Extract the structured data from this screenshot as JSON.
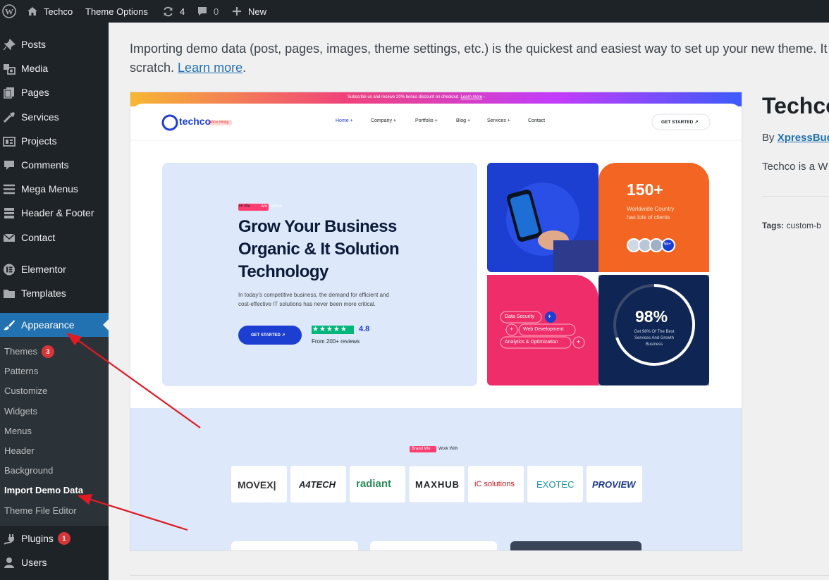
{
  "adminbar": {
    "site_name": "Techco",
    "theme_options": "Theme Options",
    "updates_count": "4",
    "comments_count": "0",
    "new_label": "New"
  },
  "sidebar": {
    "items": [
      {
        "label": "Posts",
        "icon": "pin-icon"
      },
      {
        "label": "Media",
        "icon": "media-icon"
      },
      {
        "label": "Pages",
        "icon": "pages-icon"
      },
      {
        "label": "Services",
        "icon": "tools-icon"
      },
      {
        "label": "Projects",
        "icon": "portfolio-icon"
      },
      {
        "label": "Comments",
        "icon": "comment-icon"
      },
      {
        "label": "Mega Menus",
        "icon": "menu-icon"
      },
      {
        "label": "Header & Footer",
        "icon": "layout-icon"
      },
      {
        "label": "Contact",
        "icon": "envelope-icon"
      },
      {
        "label": "Elementor",
        "icon": "elementor-icon"
      },
      {
        "label": "Templates",
        "icon": "folder-icon"
      },
      {
        "label": "Appearance",
        "icon": "brush-icon"
      },
      {
        "label": "Plugins",
        "icon": "plug-icon",
        "badge": "1"
      },
      {
        "label": "Users",
        "icon": "user-icon"
      }
    ],
    "submenu": [
      {
        "label": "Themes",
        "badge": "3"
      },
      {
        "label": "Patterns"
      },
      {
        "label": "Customize"
      },
      {
        "label": "Widgets"
      },
      {
        "label": "Menus"
      },
      {
        "label": "Header"
      },
      {
        "label": "Background"
      },
      {
        "label": "Import Demo Data"
      },
      {
        "label": "Theme File Editor"
      }
    ]
  },
  "main": {
    "intro_text": "Importing demo data (post, pages, images, theme settings, etc.) is the quickest and easiest way to set up your new theme. It",
    "intro_text2": "scratch.",
    "learn_more": "Learn more",
    "theme_title": "Techco",
    "by_label": "By",
    "author": "XpressBuddy",
    "description": "Techco is a W",
    "tags_label": "Tags:",
    "tags_value": "custom-b"
  },
  "preview": {
    "topbar": "Subscribe us and receive 20% bonus discount on checkout.",
    "topbar_link": "Learn more",
    "logo": "techco",
    "logo_tag": "We're Hiring",
    "nav": [
      "Home +",
      "Company +",
      "Portfolio +",
      "Blog +",
      "Services +",
      "Contact"
    ],
    "get_started": "GET STARTED",
    "hi_we": "Hi We",
    "are_techco": "Are Techco",
    "headline": [
      "Grow Your  Business",
      "Organic & It Solution",
      "Technology"
    ],
    "para": [
      "In today's competitive business, the demand for efficient and",
      "cost-effective IT solutions has never been more critical."
    ],
    "hero_button": "GET STARTED",
    "rating": "4.8",
    "reviews": "From 200+ reviews",
    "stat1": "150+",
    "stat1_sub": [
      "Worldwide Country",
      "has lots of clients"
    ],
    "avatar_more": "5k+",
    "chip1": "Data Security",
    "chip2": "Web Development",
    "chip3": "Analytics & Optimization",
    "stat2": "98%",
    "stat2_sub": [
      "Get 98% Of The Best",
      "Services And Growth",
      "Business"
    ],
    "brand_tag": "Brand We",
    "brand_work": "Work With",
    "brands": [
      "MOVEX|",
      "A4TECH",
      "radiant",
      "MAXHUB",
      "iC solutions",
      "EXOTEC",
      "PROVIEW"
    ]
  },
  "colors": {
    "admin_bg": "#1d2327",
    "active_blue": "#2271b1",
    "badge_red": "#d63638",
    "orange": "#f26522",
    "pink": "#ef2d6a",
    "royal_blue": "#1c3ed1",
    "arrow_red": "#e01b24"
  }
}
